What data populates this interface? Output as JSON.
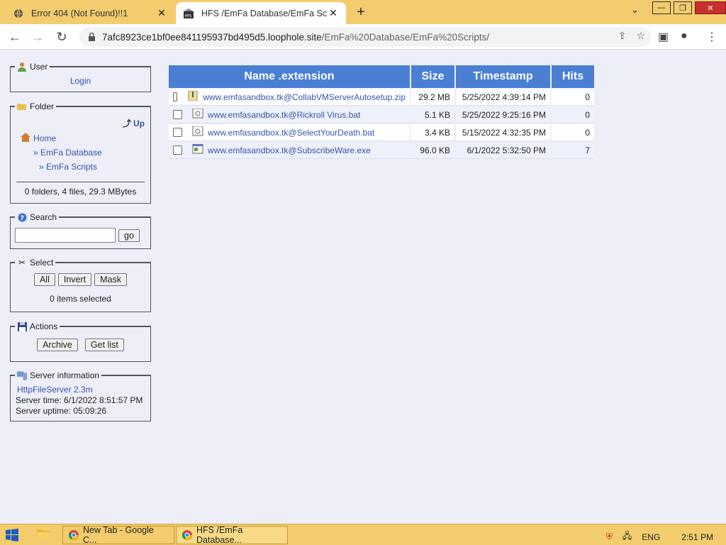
{
  "browser": {
    "tabs": [
      {
        "title": "Error 404 (Not Found)!!1",
        "active": false
      },
      {
        "title": "HFS /EmFa Database/EmFa Scripts/",
        "active": true
      }
    ],
    "url_host": "7afc8923ce1bf0ee841195937bd495d5.loophole.site",
    "url_path": "/EmFa%20Database/EmFa%20Scripts/"
  },
  "user": {
    "legend": "User",
    "login": "Login"
  },
  "folder": {
    "legend": "Folder",
    "up": "Up",
    "home": "Home",
    "crumb1": "» EmFa Database",
    "crumb2": "» EmFa Scripts",
    "summary": "0 folders, 4 files, 29.3 MBytes"
  },
  "search": {
    "legend": "Search",
    "value": "",
    "go": "go"
  },
  "select": {
    "legend": "Select",
    "all": "All",
    "invert": "Invert",
    "mask": "Mask",
    "status": "0 items selected"
  },
  "actions": {
    "legend": "Actions",
    "archive": "Archive",
    "getlist": "Get list"
  },
  "server": {
    "legend": "Server information",
    "link": "HttpFileServer 2.3m",
    "time": "Server time: 6/1/2022 8:51:57 PM",
    "uptime": "Server uptime: 05:09:26"
  },
  "table": {
    "headers": {
      "name": "Name .extension",
      "size": "Size",
      "timestamp": "Timestamp",
      "hits": "Hits"
    },
    "rows": [
      {
        "name": "www.emfasandbox.tk@CollabVMServerAutosetup.zip",
        "size": "29.2 MB",
        "timestamp": "5/25/2022 4:39:14 PM",
        "hits": "0",
        "icon": "zip-icon"
      },
      {
        "name": "www.emfasandbox.tk@Rickroll Virus.bat",
        "size": "5.1 KB",
        "timestamp": "5/25/2022 9:25:16 PM",
        "hits": "0",
        "icon": "bat-icon"
      },
      {
        "name": "www.emfasandbox.tk@SelectYourDeath.bat",
        "size": "3.4 KB",
        "timestamp": "5/15/2022 4:32:35 PM",
        "hits": "0",
        "icon": "bat-icon"
      },
      {
        "name": "www.emfasandbox.tk@SubscribeWare.exe",
        "size": "96.0 KB",
        "timestamp": "6/1/2022 5:32:50 PM",
        "hits": "7",
        "icon": "exe-icon"
      }
    ]
  },
  "taskbar": {
    "item1": "New Tab - Google C...",
    "item2": "HFS /EmFa Database...",
    "lang": "ENG",
    "time": "2:51 PM"
  },
  "colors": {
    "header": "#4a7fd4",
    "accent": "#f3cc6e",
    "link": "#3355aa"
  }
}
